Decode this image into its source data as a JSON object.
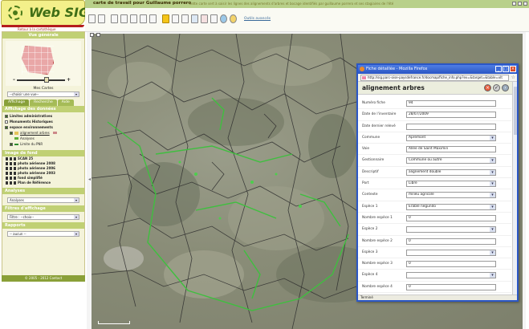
{
  "app": {
    "logo_text": "Web SIG",
    "under_logo_link": "Retour à la cartothèque",
    "topbar_title": "carte de travail pour Guillaume porrero",
    "topbar_subtitle": "cette carte sert à saisir les lignes des alignements d'arbres et bocage identifiés par guillaume porrero et ses stagiaires de l'été",
    "copyright": "© 2005 - 2012 Contact"
  },
  "toolbar": {
    "link_label": "Outils avancés"
  },
  "sidebar": {
    "overview_title": "Vue générale",
    "mes_cartes_label": "Mes Cartes",
    "mes_cartes_select": "--choisir une vue--",
    "tabs": [
      {
        "label": "Affichage"
      },
      {
        "label": "Recherche"
      },
      {
        "label": "Aide"
      }
    ],
    "data_section_title": "Affichage des données",
    "tree": [
      {
        "label": "Limites administratives"
      },
      {
        "label": "Monuments Historiques"
      },
      {
        "label": "espace environnements"
      },
      {
        "label": "alignement arbres"
      },
      {
        "label": "Analyses"
      },
      {
        "label": "Limite du PNR"
      }
    ],
    "fond_section_title": "Image de fond",
    "fonds": [
      {
        "label": "SCAN 25"
      },
      {
        "label": "photo aérienne 2008"
      },
      {
        "label": "photo aérienne 2006"
      },
      {
        "label": "photo aérienne 2003"
      },
      {
        "label": "fond simplifié"
      },
      {
        "label": "Plan de Référence"
      }
    ],
    "analyses_title": "Analyses",
    "analyses_select": "Analyses",
    "filtres_title": "Filtres d'affichage",
    "filtres_select": "Filtre : --choix--",
    "rapports_title": "Rapports",
    "rapports_select": "-- aucun --"
  },
  "popup": {
    "window_title": "Fiche détaillée - Mozilla Firefox",
    "url": "http://sig.parc-oise-paysdefrance.fr/docmap/fiche_info.php?ev=&target=&table=vlt",
    "heading": "alignement arbres",
    "status": "Terminé",
    "fields": [
      {
        "label": "Numéro fiche",
        "value": "94",
        "type": "text"
      },
      {
        "label": "Date de l'inventaire",
        "value": "28/07/2009",
        "type": "text"
      },
      {
        "label": "Date dernier relevé",
        "value": "",
        "type": "text"
      },
      {
        "label": "Commune",
        "value": "Apremont",
        "type": "select"
      },
      {
        "label": "Voie",
        "value": "Allée de Saint Maximin",
        "type": "text"
      },
      {
        "label": "Gestionnaire",
        "value": "Commune ou autre",
        "type": "select"
      },
      {
        "label": "Descriptif",
        "value": "alignement double",
        "type": "select"
      },
      {
        "label": "Port",
        "value": "Libre",
        "type": "select"
      },
      {
        "label": "Contexte",
        "value": "milieu agricole",
        "type": "select"
      },
      {
        "label": "Espèce 1",
        "value": "Erable negundo",
        "type": "select"
      },
      {
        "label": "Nombre espèce 1",
        "value": "0",
        "type": "text"
      },
      {
        "label": "Espèce 2",
        "value": "",
        "type": "select"
      },
      {
        "label": "Nombre espèce 2",
        "value": "0",
        "type": "text"
      },
      {
        "label": "Espèce 3",
        "value": "",
        "type": "select"
      },
      {
        "label": "Nombre espèce 3",
        "value": "0",
        "type": "text"
      },
      {
        "label": "Espèce 4",
        "value": "",
        "type": "select"
      },
      {
        "label": "Nombre espèce 4",
        "value": "0",
        "type": "text"
      }
    ]
  }
}
